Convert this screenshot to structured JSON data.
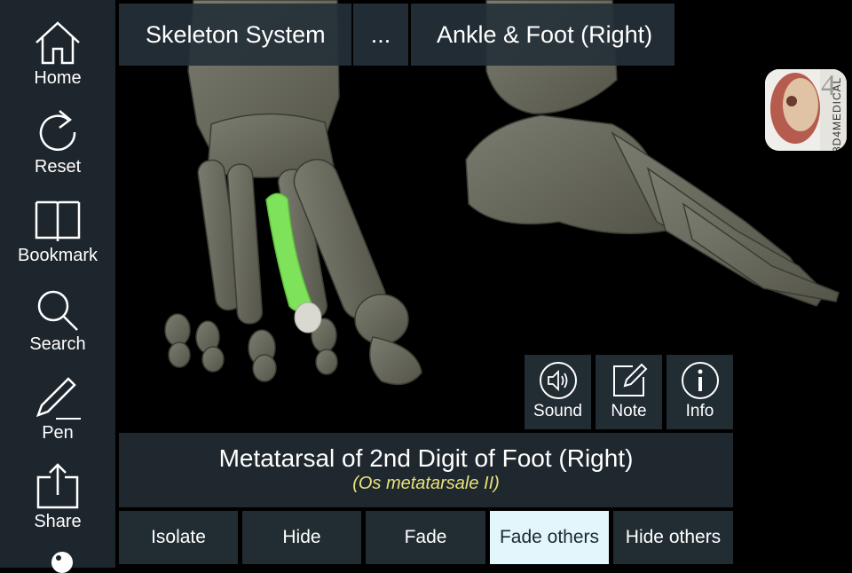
{
  "sidebar": {
    "items": [
      {
        "label": "Home",
        "icon": "home-icon"
      },
      {
        "label": "Reset",
        "icon": "reset-icon"
      },
      {
        "label": "Bookmark",
        "icon": "bookmark-icon"
      },
      {
        "label": "Search",
        "icon": "search-icon"
      },
      {
        "label": "Pen",
        "icon": "pen-icon"
      },
      {
        "label": "Share",
        "icon": "share-icon"
      }
    ]
  },
  "breadcrumb": {
    "items": [
      "Skeleton System",
      "...",
      "Ankle & Foot (Right)"
    ]
  },
  "tools": [
    {
      "label": "Sound",
      "icon": "speaker-icon"
    },
    {
      "label": "Note",
      "icon": "note-icon"
    },
    {
      "label": "Info",
      "icon": "info-icon"
    }
  ],
  "selection": {
    "name": "Metatarsal of 2nd Digit of Foot (Right)",
    "latin": "(Os metatarsale II)",
    "highlight_color": "#7ee35a"
  },
  "actions": [
    {
      "label": "Isolate",
      "active": false
    },
    {
      "label": "Hide",
      "active": false
    },
    {
      "label": "Fade",
      "active": false
    },
    {
      "label": "Fade others",
      "active": true
    },
    {
      "label": "Hide others",
      "active": false
    }
  ],
  "logo": {
    "text": "3D4MEDICAL",
    "numeral": "4"
  },
  "colors": {
    "sidebar_bg": "#1d262c",
    "panel_bg": "#1e282e",
    "button_bg": "#222c33",
    "active_button_bg": "#e2f6fb",
    "latin_text": "#e9e27a",
    "bone": "#696a5f"
  }
}
